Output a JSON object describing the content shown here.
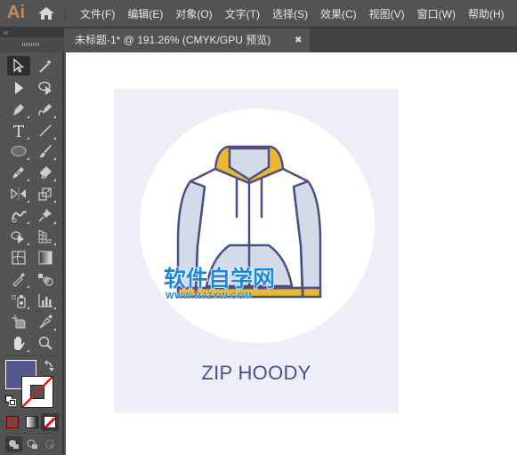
{
  "app": {
    "logo": "Ai",
    "home_icon": "home-icon"
  },
  "menu": [
    "文件(F)",
    "编辑(E)",
    "对象(O)",
    "文字(T)",
    "选择(S)",
    "效果(C)",
    "视图(V)",
    "窗口(W)",
    "帮助(H)"
  ],
  "panel": {
    "collapse_label": "‹‹"
  },
  "document_tab": {
    "title": "未标题-1* @ 191.26% (CMYK/GPU 预览)",
    "close_glyph": "✖"
  },
  "toolbar": {
    "tools": [
      {
        "name": "selection-tool",
        "icon": "selection-arrow-icon",
        "active": true
      },
      {
        "name": "magic-wand-tool",
        "icon": "magic-wand-icon"
      },
      {
        "name": "direct-selection-tool",
        "icon": "direct-selection-icon"
      },
      {
        "name": "lasso-tool",
        "icon": "lasso-icon"
      },
      {
        "name": "pen-tool",
        "icon": "pen-icon"
      },
      {
        "name": "curvature-tool",
        "icon": "curvature-icon"
      },
      {
        "name": "type-tool",
        "icon": "type-icon"
      },
      {
        "name": "line-tool",
        "icon": "line-segment-icon"
      },
      {
        "name": "ellipse-tool",
        "icon": "ellipse-icon"
      },
      {
        "name": "paintbrush-tool",
        "icon": "paintbrush-icon"
      },
      {
        "name": "shaper-tool",
        "icon": "pencil-icon"
      },
      {
        "name": "eraser-tool",
        "icon": "eraser-icon"
      },
      {
        "name": "reflect-tool",
        "icon": "reflect-icon"
      },
      {
        "name": "scale-tool",
        "icon": "scale-icon"
      },
      {
        "name": "warp-tool",
        "icon": "warp-icon"
      },
      {
        "name": "puppet-warp-tool",
        "icon": "pin-icon"
      },
      {
        "name": "shape-builder-tool",
        "icon": "shape-builder-icon"
      },
      {
        "name": "perspective-grid-tool",
        "icon": "perspective-grid-icon"
      },
      {
        "name": "mesh-tool",
        "icon": "mesh-icon"
      },
      {
        "name": "gradient-tool",
        "icon": "gradient-icon"
      },
      {
        "name": "eyedropper-tool",
        "icon": "eyedropper-icon"
      },
      {
        "name": "blend-tool",
        "icon": "blend-icon"
      },
      {
        "name": "symbol-sprayer-tool",
        "icon": "symbol-sprayer-icon"
      },
      {
        "name": "column-graph-tool",
        "icon": "column-graph-icon"
      },
      {
        "name": "artboard-tool",
        "icon": "artboard-icon"
      },
      {
        "name": "slice-tool",
        "icon": "slice-knife-icon"
      },
      {
        "name": "hand-tool",
        "icon": "hand-icon"
      },
      {
        "name": "zoom-tool",
        "icon": "magnifier-icon"
      }
    ],
    "fill_color": "#55588c",
    "stroke_color": "none"
  },
  "artwork": {
    "label": "ZIP HOODY",
    "background": "#eeeef8",
    "outline_color": "#4d4f82",
    "body_color": "#ffffff",
    "sleeve_color": "#d4dbe8",
    "accent_color": "#e9b830",
    "watermark_cn": "软件自学网",
    "watermark_en": "WWW.RJZXW.COM"
  }
}
